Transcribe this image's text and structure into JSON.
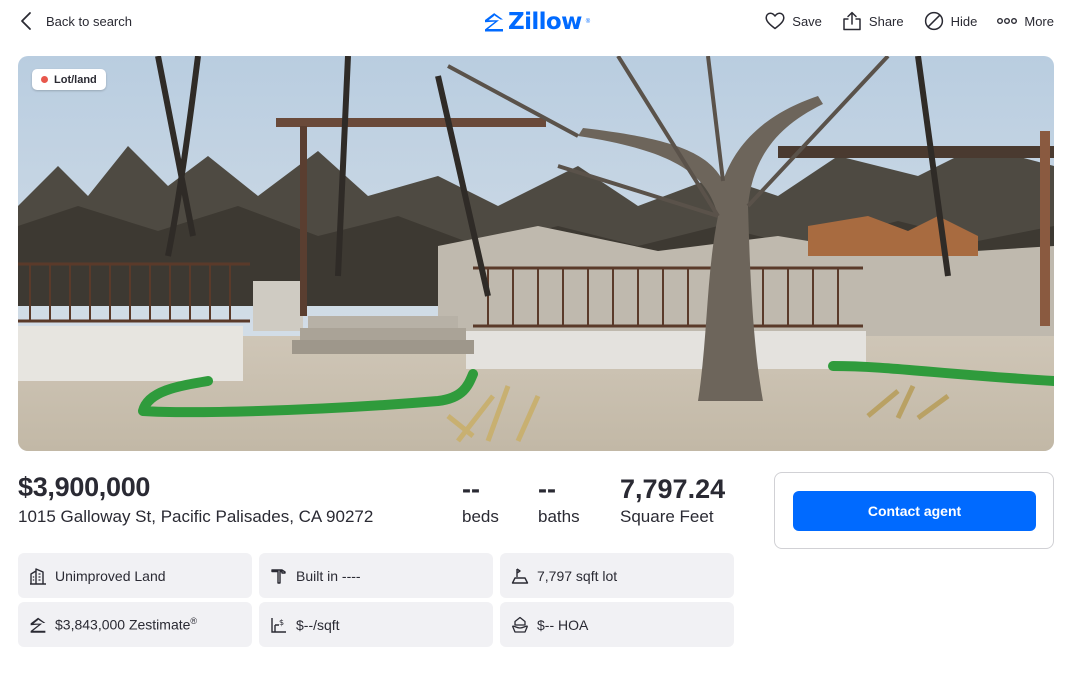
{
  "header": {
    "back_label": "Back to search",
    "logo_text": "Zillow",
    "logo_mark": "®",
    "actions": {
      "save": "Save",
      "share": "Share",
      "hide": "Hide",
      "more": "More"
    }
  },
  "photo": {
    "tag_label": "Lot/land",
    "tag_dot_color": "#e8574c",
    "description_icon": "photo"
  },
  "listing": {
    "price": "$3,900,000",
    "address": "1015 Galloway St, Pacific Palisades, CA 90272",
    "beds_value": "--",
    "beds_label": "beds",
    "baths_value": "--",
    "baths_label": "baths",
    "sqft_value": "7,797.24",
    "sqft_label": "Square Feet"
  },
  "contact": {
    "button_label": "Contact agent"
  },
  "facts": {
    "type": "Unimproved Land",
    "built": "Built in ----",
    "lot": "7,797 sqft lot",
    "zestimate": "$3,843,000 Zestimate",
    "zestimate_mark": "®",
    "price_per_sqft": "$--/sqft",
    "hoa": "$-- HOA"
  },
  "colors": {
    "brand": "#006aff",
    "text": "#2a2a33",
    "chip_bg": "#f1f1f4"
  }
}
